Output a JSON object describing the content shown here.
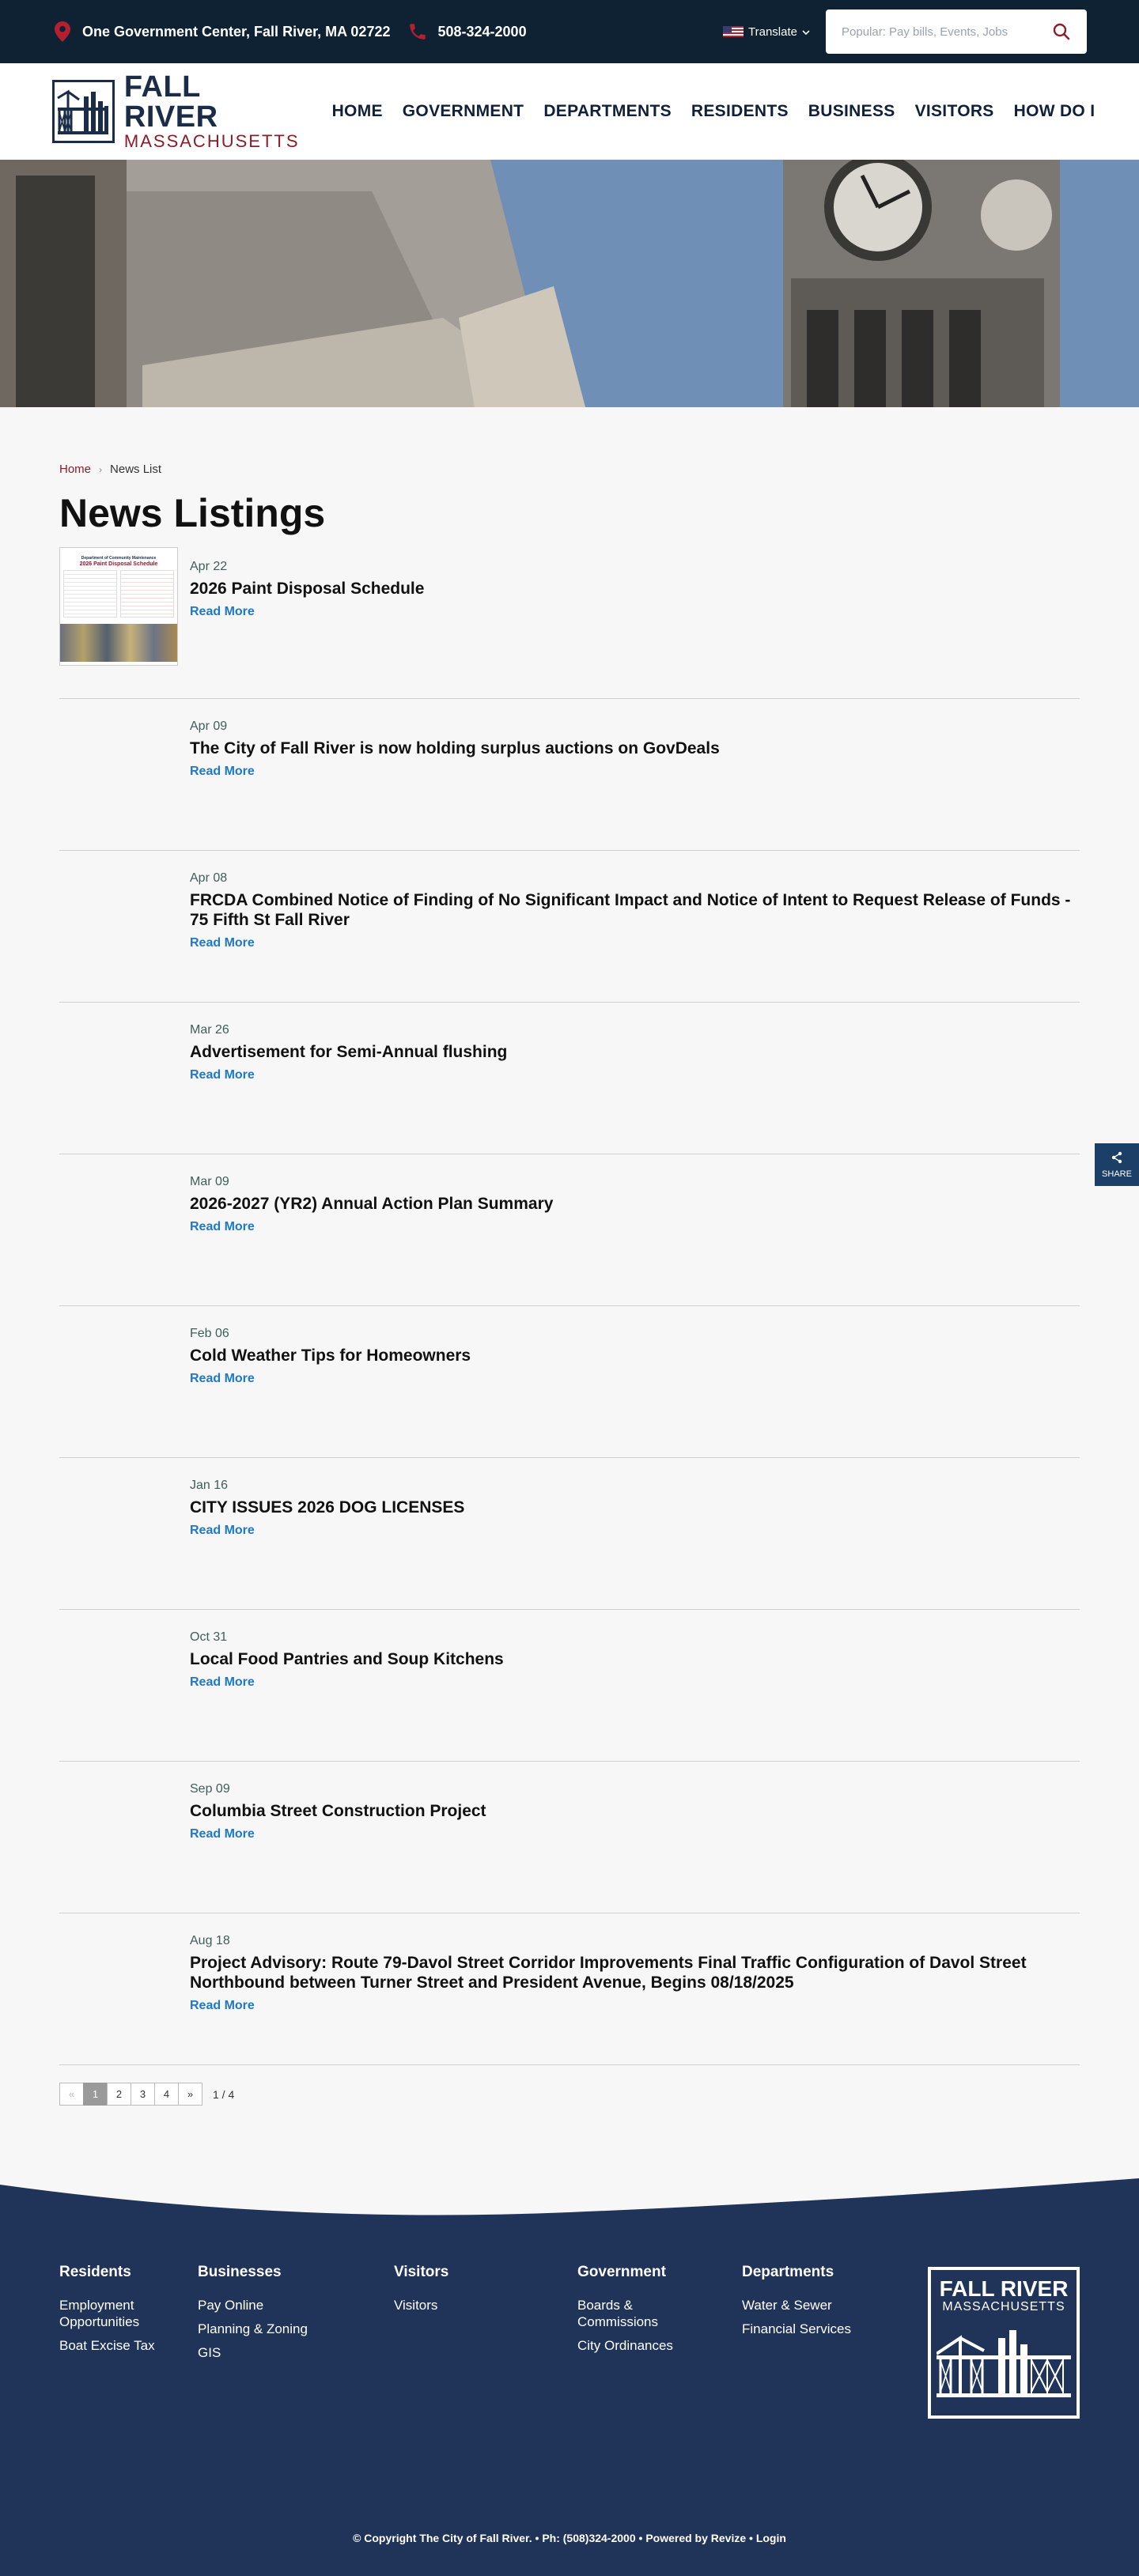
{
  "topbar": {
    "address": "One Government Center, Fall River, MA 02722",
    "phone": "508-324-2000",
    "translate_label": "Translate",
    "search_placeholder": "Popular: Pay bills, Events, Jobs"
  },
  "logo": {
    "line1": "FALL RIVER",
    "line2": "MASSACHUSETTS"
  },
  "nav": [
    "HOME",
    "GOVERNMENT",
    "DEPARTMENTS",
    "RESIDENTS",
    "BUSINESS",
    "VISITORS",
    "HOW DO I"
  ],
  "breadcrumb": {
    "home": "Home",
    "current": "News List"
  },
  "page_title": "News Listings",
  "thumb": {
    "heading": "Department of Community Maintenance",
    "title": "2026 Paint Disposal Schedule"
  },
  "read_more_label": "Read More",
  "news": [
    {
      "date": "Apr 22",
      "title": "2026 Paint Disposal Schedule"
    },
    {
      "date": "Apr 09",
      "title": "The City of Fall River is now holding surplus auctions on GovDeals"
    },
    {
      "date": "Apr 08",
      "title": "FRCDA Combined Notice of Finding of No Significant Impact and Notice of Intent to Request Release of Funds  - 75 Fifth St Fall River"
    },
    {
      "date": "Mar 26",
      "title": "Advertisement for Semi-Annual flushing"
    },
    {
      "date": "Mar 09",
      "title": "2026-2027 (YR2) Annual Action Plan Summary"
    },
    {
      "date": "Feb 06",
      "title": "Cold Weather Tips for Homeowners"
    },
    {
      "date": "Jan 16",
      "title": "CITY ISSUES 2026 DOG LICENSES"
    },
    {
      "date": "Oct 31",
      "title": "Local Food Pantries and Soup Kitchens"
    },
    {
      "date": "Sep 09",
      "title": "Columbia Street Construction Project"
    },
    {
      "date": "Aug 18",
      "title": "Project Advisory: Route 79-Davol Street Corridor Improvements Final Traffic Configuration of Davol Street Northbound between Turner Street and President Avenue, Begins 08/18/2025"
    }
  ],
  "pagination": {
    "prev": "«",
    "pages": [
      "1",
      "2",
      "3",
      "4"
    ],
    "next": "»",
    "count": "1 / 4",
    "current": "1"
  },
  "share_label": "SHARE",
  "footer": {
    "columns": [
      {
        "heading": "Residents",
        "links": [
          "Employment Opportunities",
          "Boat Excise Tax"
        ]
      },
      {
        "heading": "Businesses",
        "links": [
          "Pay Online",
          "Planning & Zoning",
          "GIS"
        ]
      },
      {
        "heading": "Visitors",
        "links": [
          "Visitors"
        ]
      },
      {
        "heading": "Government",
        "links": [
          "Boards & Commissions",
          "City Ordinances"
        ]
      },
      {
        "heading": "Departments",
        "links": [
          "Water & Sewer",
          "Financial Services"
        ]
      }
    ],
    "logo_line1": "FALL RIVER",
    "logo_line2": "MASSACHUSETTS",
    "copyright": "© Copyright The City of Fall River.",
    "phone": "Ph: (508)324-2000",
    "powered": "Powered by Revize",
    "login": "Login"
  },
  "colors": {
    "topbar": "#0f2233",
    "navy": "#1b2c48",
    "maroon": "#8c1c2b",
    "link": "#1f78c8",
    "footer": "#203359"
  }
}
